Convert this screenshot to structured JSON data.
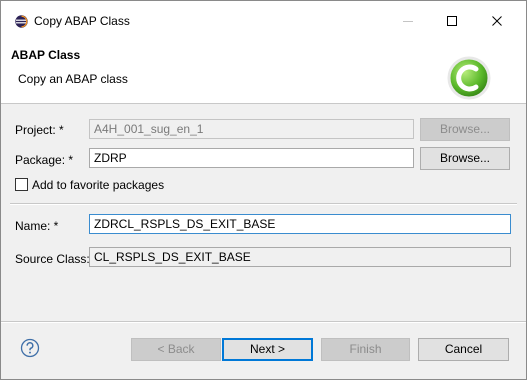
{
  "window": {
    "title": "Copy ABAP Class"
  },
  "header": {
    "title": "ABAP Class",
    "subtitle": "Copy an ABAP class"
  },
  "form": {
    "project": {
      "label": "Project: *",
      "value": "A4H_001_sug_en_1",
      "browse_label": "Browse..."
    },
    "package": {
      "label": "Package: *",
      "value": "ZDRP",
      "browse_label": "Browse..."
    },
    "favorite": {
      "label": "Add to favorite packages",
      "checked": false
    },
    "name": {
      "label": "Name: *",
      "value": "ZDRCL_RSPLS_DS_EXIT_BASE"
    },
    "source_class": {
      "label": "Source Class:",
      "value": "CL_RSPLS_DS_EXIT_BASE"
    }
  },
  "footer": {
    "back_label": "< Back",
    "next_label": "Next >",
    "finish_label": "Finish",
    "cancel_label": "Cancel"
  },
  "colors": {
    "focus_border": "#3a8ccf",
    "default_button_border": "#0078d7",
    "wizard_graphic": "#5ab82a"
  }
}
